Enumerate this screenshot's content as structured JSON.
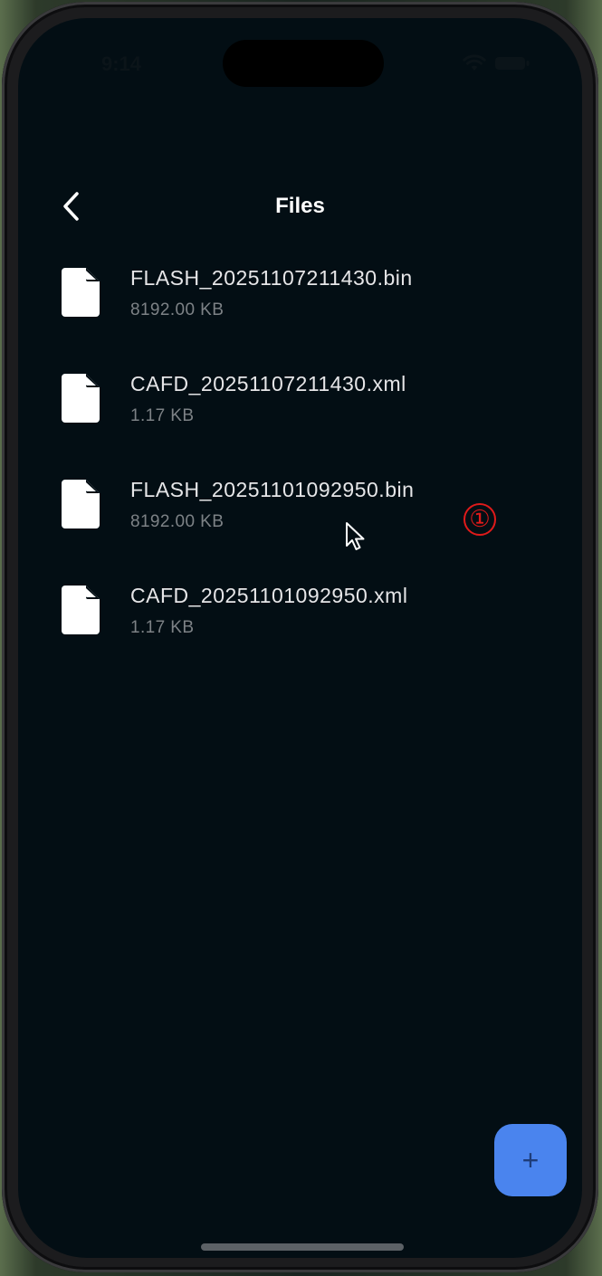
{
  "status_bar": {
    "time": "9:14",
    "icons": [
      "wifi-icon",
      "battery-icon"
    ]
  },
  "header": {
    "title": "Files",
    "back_icon": "chevron-left-icon"
  },
  "files": [
    {
      "name": "FLASH_20251107211430.bin",
      "size": "8192.00 KB",
      "icon": "document-icon"
    },
    {
      "name": "CAFD_20251107211430.xml",
      "size": "1.17 KB",
      "icon": "document-icon"
    },
    {
      "name": "FLASH_20251101092950.bin",
      "size": "8192.00 KB",
      "icon": "document-icon"
    },
    {
      "name": "CAFD_20251101092950.xml",
      "size": "1.17 KB",
      "icon": "document-icon"
    }
  ],
  "annotation": {
    "marker": "①"
  },
  "fab": {
    "label": "+",
    "icon": "plus-icon"
  },
  "colors": {
    "background": "#030e14",
    "text_primary": "#e6e6e8",
    "text_secondary": "#7d8286",
    "fab": "#4a84ee",
    "annotation": "#e01a1a"
  }
}
